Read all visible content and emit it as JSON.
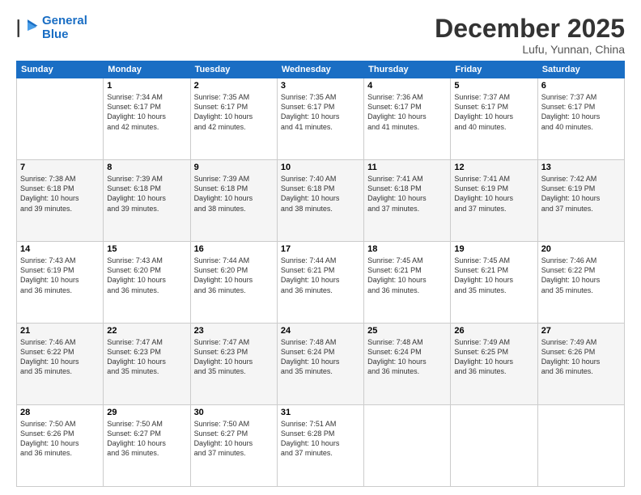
{
  "logo": {
    "line1": "General",
    "line2": "Blue"
  },
  "title": "December 2025",
  "location": "Lufu, Yunnan, China",
  "days_header": [
    "Sunday",
    "Monday",
    "Tuesday",
    "Wednesday",
    "Thursday",
    "Friday",
    "Saturday"
  ],
  "weeks": [
    [
      {
        "num": "",
        "info": ""
      },
      {
        "num": "1",
        "info": "Sunrise: 7:34 AM\nSunset: 6:17 PM\nDaylight: 10 hours\nand 42 minutes."
      },
      {
        "num": "2",
        "info": "Sunrise: 7:35 AM\nSunset: 6:17 PM\nDaylight: 10 hours\nand 42 minutes."
      },
      {
        "num": "3",
        "info": "Sunrise: 7:35 AM\nSunset: 6:17 PM\nDaylight: 10 hours\nand 41 minutes."
      },
      {
        "num": "4",
        "info": "Sunrise: 7:36 AM\nSunset: 6:17 PM\nDaylight: 10 hours\nand 41 minutes."
      },
      {
        "num": "5",
        "info": "Sunrise: 7:37 AM\nSunset: 6:17 PM\nDaylight: 10 hours\nand 40 minutes."
      },
      {
        "num": "6",
        "info": "Sunrise: 7:37 AM\nSunset: 6:17 PM\nDaylight: 10 hours\nand 40 minutes."
      }
    ],
    [
      {
        "num": "7",
        "info": "Sunrise: 7:38 AM\nSunset: 6:18 PM\nDaylight: 10 hours\nand 39 minutes."
      },
      {
        "num": "8",
        "info": "Sunrise: 7:39 AM\nSunset: 6:18 PM\nDaylight: 10 hours\nand 39 minutes."
      },
      {
        "num": "9",
        "info": "Sunrise: 7:39 AM\nSunset: 6:18 PM\nDaylight: 10 hours\nand 38 minutes."
      },
      {
        "num": "10",
        "info": "Sunrise: 7:40 AM\nSunset: 6:18 PM\nDaylight: 10 hours\nand 38 minutes."
      },
      {
        "num": "11",
        "info": "Sunrise: 7:41 AM\nSunset: 6:18 PM\nDaylight: 10 hours\nand 37 minutes."
      },
      {
        "num": "12",
        "info": "Sunrise: 7:41 AM\nSunset: 6:19 PM\nDaylight: 10 hours\nand 37 minutes."
      },
      {
        "num": "13",
        "info": "Sunrise: 7:42 AM\nSunset: 6:19 PM\nDaylight: 10 hours\nand 37 minutes."
      }
    ],
    [
      {
        "num": "14",
        "info": "Sunrise: 7:43 AM\nSunset: 6:19 PM\nDaylight: 10 hours\nand 36 minutes."
      },
      {
        "num": "15",
        "info": "Sunrise: 7:43 AM\nSunset: 6:20 PM\nDaylight: 10 hours\nand 36 minutes."
      },
      {
        "num": "16",
        "info": "Sunrise: 7:44 AM\nSunset: 6:20 PM\nDaylight: 10 hours\nand 36 minutes."
      },
      {
        "num": "17",
        "info": "Sunrise: 7:44 AM\nSunset: 6:21 PM\nDaylight: 10 hours\nand 36 minutes."
      },
      {
        "num": "18",
        "info": "Sunrise: 7:45 AM\nSunset: 6:21 PM\nDaylight: 10 hours\nand 36 minutes."
      },
      {
        "num": "19",
        "info": "Sunrise: 7:45 AM\nSunset: 6:21 PM\nDaylight: 10 hours\nand 35 minutes."
      },
      {
        "num": "20",
        "info": "Sunrise: 7:46 AM\nSunset: 6:22 PM\nDaylight: 10 hours\nand 35 minutes."
      }
    ],
    [
      {
        "num": "21",
        "info": "Sunrise: 7:46 AM\nSunset: 6:22 PM\nDaylight: 10 hours\nand 35 minutes."
      },
      {
        "num": "22",
        "info": "Sunrise: 7:47 AM\nSunset: 6:23 PM\nDaylight: 10 hours\nand 35 minutes."
      },
      {
        "num": "23",
        "info": "Sunrise: 7:47 AM\nSunset: 6:23 PM\nDaylight: 10 hours\nand 35 minutes."
      },
      {
        "num": "24",
        "info": "Sunrise: 7:48 AM\nSunset: 6:24 PM\nDaylight: 10 hours\nand 35 minutes."
      },
      {
        "num": "25",
        "info": "Sunrise: 7:48 AM\nSunset: 6:24 PM\nDaylight: 10 hours\nand 36 minutes."
      },
      {
        "num": "26",
        "info": "Sunrise: 7:49 AM\nSunset: 6:25 PM\nDaylight: 10 hours\nand 36 minutes."
      },
      {
        "num": "27",
        "info": "Sunrise: 7:49 AM\nSunset: 6:26 PM\nDaylight: 10 hours\nand 36 minutes."
      }
    ],
    [
      {
        "num": "28",
        "info": "Sunrise: 7:50 AM\nSunset: 6:26 PM\nDaylight: 10 hours\nand 36 minutes."
      },
      {
        "num": "29",
        "info": "Sunrise: 7:50 AM\nSunset: 6:27 PM\nDaylight: 10 hours\nand 36 minutes."
      },
      {
        "num": "30",
        "info": "Sunrise: 7:50 AM\nSunset: 6:27 PM\nDaylight: 10 hours\nand 37 minutes."
      },
      {
        "num": "31",
        "info": "Sunrise: 7:51 AM\nSunset: 6:28 PM\nDaylight: 10 hours\nand 37 minutes."
      },
      {
        "num": "",
        "info": ""
      },
      {
        "num": "",
        "info": ""
      },
      {
        "num": "",
        "info": ""
      }
    ]
  ]
}
